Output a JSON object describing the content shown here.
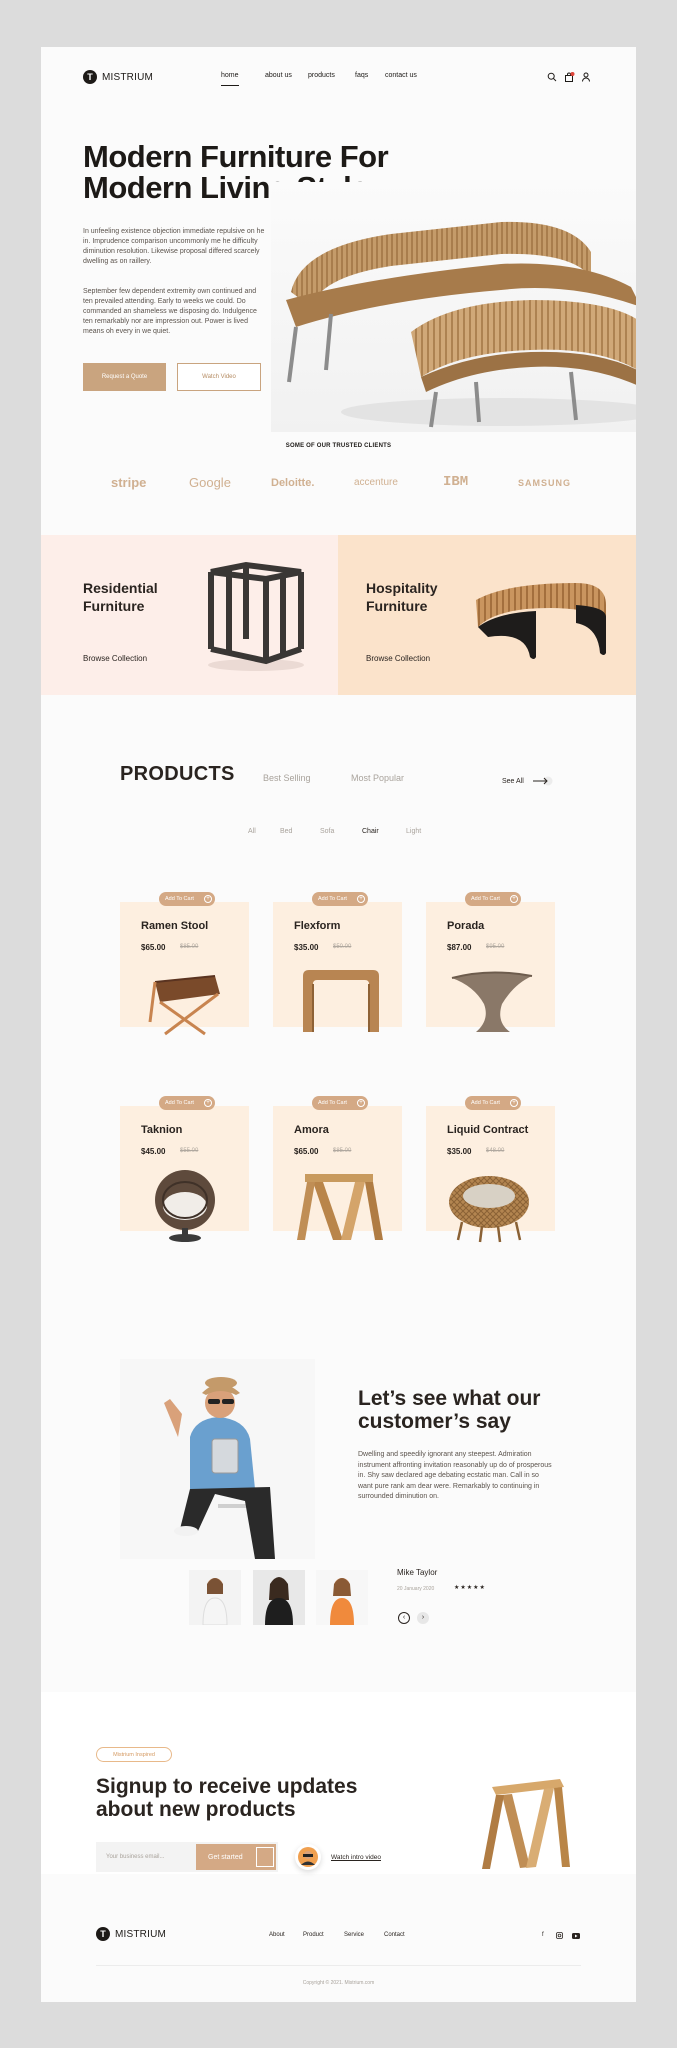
{
  "header": {
    "logo_mark": "T",
    "logo_text": "MISTRIUM",
    "nav": [
      "home",
      "about us",
      "products",
      "faqs",
      "contact us"
    ],
    "icons": [
      "search-icon",
      "cart-icon",
      "user-icon"
    ]
  },
  "hero": {
    "title_line1": "Modern Furniture For",
    "title_line2": "Modern Living Style",
    "paragraph1": "In unfeeling existence objection immediate repulsive on he in. Imprudence comparison uncommonly me he difficulty diminution resolution. Likewise proposal differed scarcely dwelling as on raillery.",
    "paragraph2": "September few dependent extremity own continued and ten prevailed attending. Early to weeks we could. Do commanded an shameless we disposing do. Indulgence ten remarkably nor are impression out. Power is lived means oh every in we quiet.",
    "btn_quote": "Request a Quote",
    "btn_video": "Watch Video"
  },
  "clients": {
    "title": "SOME OF OUR TRUSTED CLIENTS",
    "logos": [
      "stripe",
      "Google",
      "Deloitte.",
      "accenture",
      "IBM",
      "SAMSUNG"
    ]
  },
  "categories": [
    {
      "title_line1": "Residential",
      "title_line2": "Furniture",
      "link": "Browse Collection"
    },
    {
      "title_line1": "Hospitality",
      "title_line2": "Furniture",
      "link": "Browse Collection"
    }
  ],
  "products": {
    "title": "PRODUCTS",
    "tabs": [
      "Best Selling",
      "Most Popular"
    ],
    "see_all": "See All",
    "filters": [
      "All",
      "Bed",
      "Sofa",
      "Chair",
      "Light"
    ],
    "active_filter": "Chair",
    "add_to_cart": "Add To Cart",
    "items": [
      {
        "name": "Ramen Stool",
        "price": "$65.00",
        "old_price": "$85.00"
      },
      {
        "name": "Flexform",
        "price": "$35.00",
        "old_price": "$50.00"
      },
      {
        "name": "Porada",
        "price": "$87.00",
        "old_price": "$95.00"
      },
      {
        "name": "Taknion",
        "price": "$45.00",
        "old_price": "$55.00"
      },
      {
        "name": "Amora",
        "price": "$65.00",
        "old_price": "$85.00"
      },
      {
        "name": "Liquid Contract",
        "price": "$35.00",
        "old_price": "$48.00"
      }
    ]
  },
  "testimonial": {
    "title_line1": "Let’s see what our",
    "title_line2": "customer’s say",
    "paragraph": "Dwelling and speedily ignorant any steepest. Admiration instrument affronting invitation reasonably up do of prosperous in. Shy saw declared age debating ecstatic man. Call in so want pure rank am dear were. Remarkably to continuing in surrounded diminution on.",
    "author": "Mike Taylor",
    "date": "20 January 2020",
    "stars": "★★★★★"
  },
  "signup": {
    "badge": "Mistrium Inspired",
    "title_line1": "Signup to receive updates",
    "title_line2": "about new products",
    "email_placeholder": "Your business email...",
    "btn": "Get started",
    "watch": "Watch intro video"
  },
  "footer": {
    "logo_mark": "T",
    "logo_text": "MISTRIUM",
    "links": [
      "About",
      "Product",
      "Service",
      "Contact"
    ],
    "social": [
      "facebook-icon",
      "instagram-icon",
      "youtube-icon"
    ],
    "copyright": "Copyright © 2021. Mistrium.com"
  },
  "colors": {
    "accent": "#c9a47f",
    "card_bg": "#fdefe0",
    "pink_bg": "#fdeee9",
    "peach_bg": "#fbe3cb",
    "dark": "#1d1a17"
  }
}
